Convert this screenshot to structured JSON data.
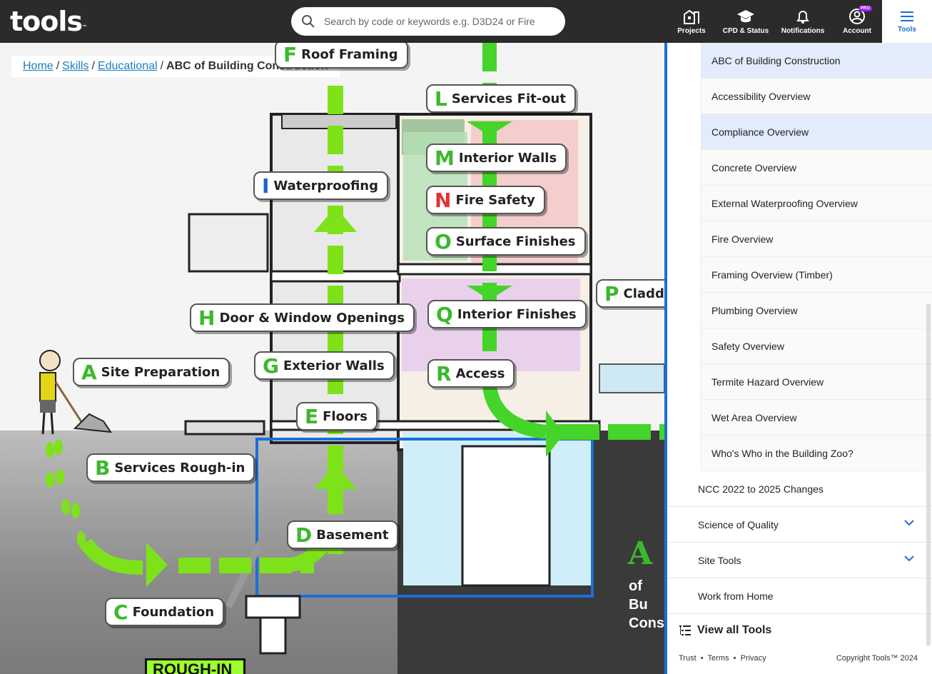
{
  "header": {
    "logo": "tools",
    "logo_tm": "™",
    "search_placeholder": "Search by code or keywords e.g. D3D24 or Fire",
    "nav": [
      {
        "label": "Projects",
        "icon": "projects-icon"
      },
      {
        "label": "CPD & Status",
        "icon": "mortarboard-icon"
      },
      {
        "label": "Notifications",
        "icon": "bell-icon"
      },
      {
        "label": "Account",
        "icon": "account-icon",
        "badge": "PRO"
      },
      {
        "label": "Tools",
        "icon": "hamburger-icon",
        "active": true
      }
    ]
  },
  "breadcrumb": {
    "items": [
      "Home",
      "Skills",
      "Educational"
    ],
    "current": "ABC of Building Construction",
    "sep": "/"
  },
  "diagram": {
    "tags": [
      {
        "letter": "F",
        "label": "Roof Framing",
        "color": "green"
      },
      {
        "letter": "L",
        "label": "Services Fit-out",
        "color": "green"
      },
      {
        "letter": "M",
        "label": "Interior Walls",
        "color": "green"
      },
      {
        "letter": "I",
        "label": "Waterproofing",
        "color": "blue"
      },
      {
        "letter": "N",
        "label": "Fire Safety",
        "color": "red"
      },
      {
        "letter": "O",
        "label": "Surface Finishes",
        "color": "green"
      },
      {
        "letter": "P",
        "label": "Claddi",
        "color": "green"
      },
      {
        "letter": "H",
        "label": "Door & Window Openings",
        "color": "green"
      },
      {
        "letter": "Q",
        "label": "Interior Finishes",
        "color": "green"
      },
      {
        "letter": "A",
        "label": "Site Preparation",
        "color": "green"
      },
      {
        "letter": "G",
        "label": "Exterior Walls",
        "color": "green"
      },
      {
        "letter": "R",
        "label": "Access",
        "color": "green"
      },
      {
        "letter": "E",
        "label": "Floors",
        "color": "green"
      },
      {
        "letter": "B",
        "label": "Services Rough-in",
        "color": "green"
      },
      {
        "letter": "D",
        "label": "Basement",
        "color": "green"
      },
      {
        "letter": "C",
        "label": "Foundation",
        "color": "green"
      }
    ],
    "rough_in": "ROUGH-IN",
    "title_letter": "A",
    "title_line1": "of Bu",
    "title_line2": "Cons"
  },
  "sidebar": {
    "sub_items": [
      {
        "label": "ABC of Building Construction",
        "highlight": true
      },
      {
        "label": "Accessibility Overview"
      },
      {
        "label": "Compliance Overview",
        "highlight": true
      },
      {
        "label": "Concrete Overview"
      },
      {
        "label": "External Waterproofing Overview"
      },
      {
        "label": "Fire Overview"
      },
      {
        "label": "Framing Overview (Timber)"
      },
      {
        "label": "Plumbing Overview"
      },
      {
        "label": "Safety Overview"
      },
      {
        "label": "Termite Hazard Overview"
      },
      {
        "label": "Wet Area Overview"
      },
      {
        "label": "Who's Who in the Building Zoo?"
      }
    ],
    "top_items": [
      {
        "label": "NCC 2022 to 2025 Changes",
        "expandable": false
      },
      {
        "label": "Science of Quality",
        "expandable": true
      },
      {
        "label": "Site Tools",
        "expandable": true
      },
      {
        "label": "Work from Home",
        "expandable": false
      }
    ],
    "view_all": "View all Tools",
    "footer_links": [
      "Trust",
      "Terms",
      "Privacy"
    ],
    "copyright": "Copyright Tools™ 2024",
    "accent": "#1a6fd6"
  }
}
